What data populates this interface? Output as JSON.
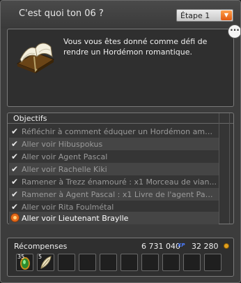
{
  "window": {
    "title": "C'est quoi ton 06 ?"
  },
  "step_select": {
    "value": "Étape 1"
  },
  "description": {
    "text": "Vous vous êtes donné comme défi de rendre un Hordémon romantique."
  },
  "objectives": {
    "header": "Objectifs",
    "items": [
      {
        "label": "Réfléchir à comment éduquer un Hordémon amo...",
        "done": true
      },
      {
        "label": "Aller voir Hibuspokus",
        "done": true
      },
      {
        "label": "Aller voir Agent Pascal",
        "done": true
      },
      {
        "label": "Aller voir Rachelle Kiki",
        "done": true
      },
      {
        "label": "Ramener à Trezz énamouré : x1 Morceau de vian...",
        "done": true
      },
      {
        "label": "Ramener à Agent Pascal : x1 Livre de l'agent Pascal",
        "done": true
      },
      {
        "label": "Aller voir Rita Foulmétal",
        "done": true
      },
      {
        "label": "Aller voir Lieutenant Braylle",
        "done": false
      }
    ]
  },
  "rewards": {
    "label": "Récompenses",
    "xp": "6 731 040",
    "kamas": "32 280",
    "items": [
      {
        "qty": "35",
        "icon": "green-gem-icon"
      },
      {
        "qty": "5",
        "icon": "feather-icon"
      }
    ]
  },
  "colors": {
    "accent": "#e05a10",
    "xp": "#4a7cff",
    "kamas": "#e0a020"
  }
}
